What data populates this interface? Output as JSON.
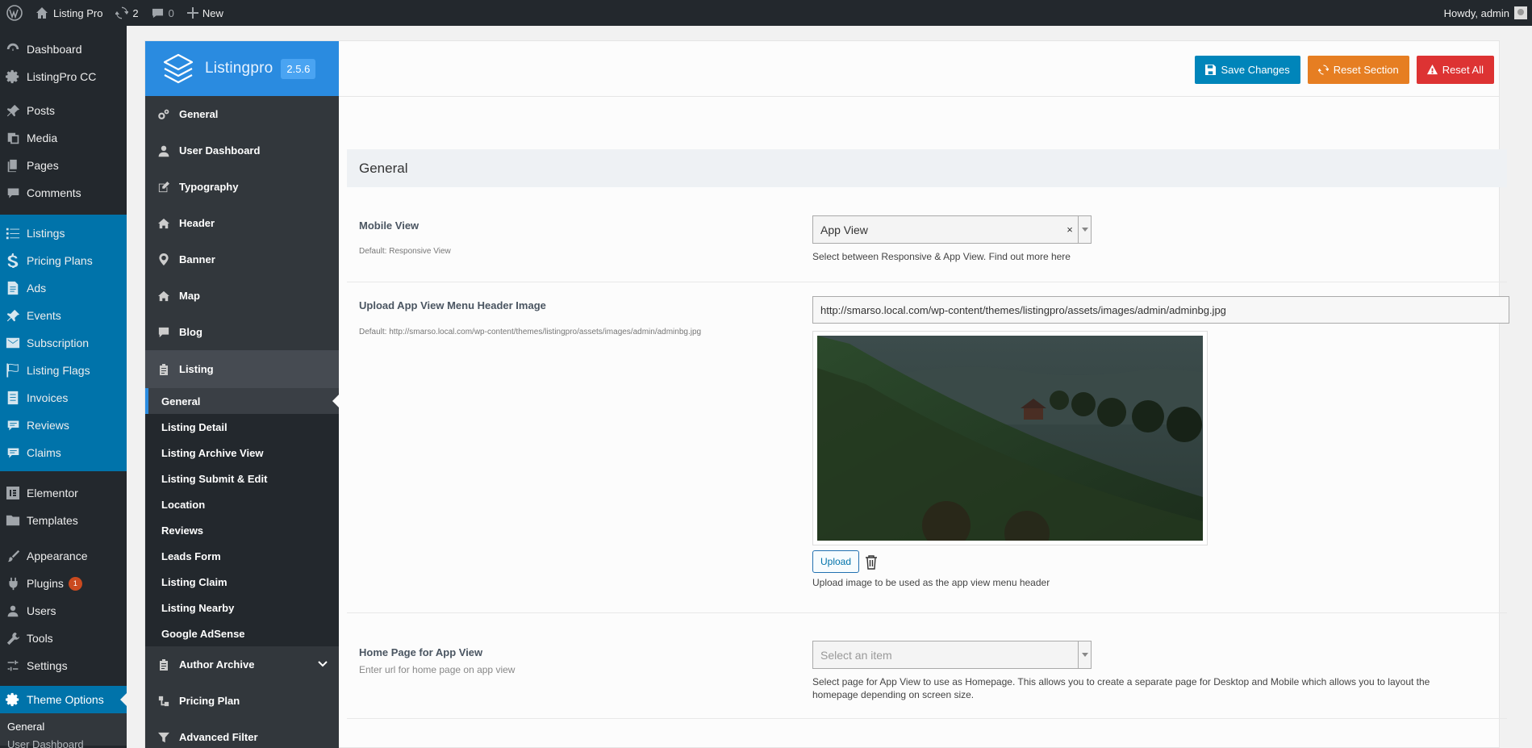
{
  "adminbar": {
    "site_name": "Listing Pro",
    "updates_count": "2",
    "comments_count": "0",
    "new_label": "New",
    "howdy": "Howdy, admin"
  },
  "wp_menu": {
    "group1": [
      {
        "label": "Dashboard",
        "icon": "dashboard-icon"
      },
      {
        "label": "ListingPro CC",
        "icon": "gear-icon"
      }
    ],
    "group2": [
      {
        "label": "Posts",
        "icon": "pin-icon"
      },
      {
        "label": "Media",
        "icon": "media-icon"
      },
      {
        "label": "Pages",
        "icon": "pages-icon"
      },
      {
        "label": "Comments",
        "icon": "comments-icon"
      }
    ],
    "group3": [
      {
        "label": "Listings",
        "icon": "list-icon"
      },
      {
        "label": "Pricing Plans",
        "icon": "dollar-icon"
      },
      {
        "label": "Ads",
        "icon": "ads-icon"
      },
      {
        "label": "Events",
        "icon": "pin-icon"
      },
      {
        "label": "Subscription",
        "icon": "mail-icon"
      },
      {
        "label": "Listing Flags",
        "icon": "flag-icon"
      },
      {
        "label": "Invoices",
        "icon": "invoice-icon"
      },
      {
        "label": "Reviews",
        "icon": "reviews-icon"
      },
      {
        "label": "Claims",
        "icon": "claims-icon"
      }
    ],
    "group4": [
      {
        "label": "Elementor",
        "icon": "elementor-icon"
      },
      {
        "label": "Templates",
        "icon": "folder-icon"
      }
    ],
    "group5": [
      {
        "label": "Appearance",
        "icon": "brush-icon"
      },
      {
        "label": "Plugins",
        "icon": "plug-icon",
        "badge": "1"
      },
      {
        "label": "Users",
        "icon": "user-icon"
      },
      {
        "label": "Tools",
        "icon": "wrench-icon"
      },
      {
        "label": "Settings",
        "icon": "settings-icon"
      }
    ],
    "current": {
      "label": "Theme Options",
      "icon": "gear-icon"
    },
    "submenu": [
      "General",
      "User Dashboard"
    ]
  },
  "panel": {
    "logo_name": "Listingpro",
    "version": "2.5.6",
    "nav_top": [
      {
        "label": "General",
        "icon": "gears-icon"
      },
      {
        "label": "User Dashboard",
        "icon": "user-icon"
      },
      {
        "label": "Typography",
        "icon": "edit-icon"
      },
      {
        "label": "Header",
        "icon": "home-icon"
      },
      {
        "label": "Banner",
        "icon": "map-marker-icon"
      },
      {
        "label": "Map",
        "icon": "home-icon"
      },
      {
        "label": "Blog",
        "icon": "comment-icon"
      }
    ],
    "nav_active": {
      "label": "Listing",
      "icon": "clipboard-icon"
    },
    "nav_sub": [
      "General",
      "Listing Detail",
      "Listing Archive View",
      "Listing Submit & Edit",
      "Location",
      "Reviews",
      "Leads Form",
      "Listing Claim",
      "Listing Nearby",
      "Google AdSense"
    ],
    "nav_bottom": [
      {
        "label": "Author Archive",
        "icon": "clipboard-icon"
      },
      {
        "label": "Pricing Plan",
        "icon": "sitemap-icon"
      },
      {
        "label": "Advanced Filter",
        "icon": "filter-icon"
      }
    ],
    "buttons": {
      "save": "Save Changes",
      "reset_section": "Reset Section",
      "reset_all": "Reset All"
    },
    "section_title": "General",
    "fields": {
      "mobile_view": {
        "label": "Mobile View",
        "default": "Default: Responsive View",
        "value": "App View",
        "help": "Select between Responsive & App View. Find out more here"
      },
      "header_image": {
        "label": "Upload App View Menu Header Image",
        "default": "Default: http://smarso.local.com/wp-content/themes/listingpro/assets/images/admin/adminbg.jpg",
        "url": "http://smarso.local.com/wp-content/themes/listingpro/assets/images/admin/adminbg.jpg",
        "upload_label": "Upload",
        "help": "Upload image to be used as the app view menu header"
      },
      "home_page": {
        "label": "Home Page for App View",
        "subtitle": "Enter url for home page on app view",
        "placeholder": "Select an item",
        "help_line1": "Select page for App View to use as Homepage. This allows you to create a separate page for Desktop and Mobile which allows you to layout the",
        "help_line2": "homepage depending on screen size."
      }
    }
  }
}
